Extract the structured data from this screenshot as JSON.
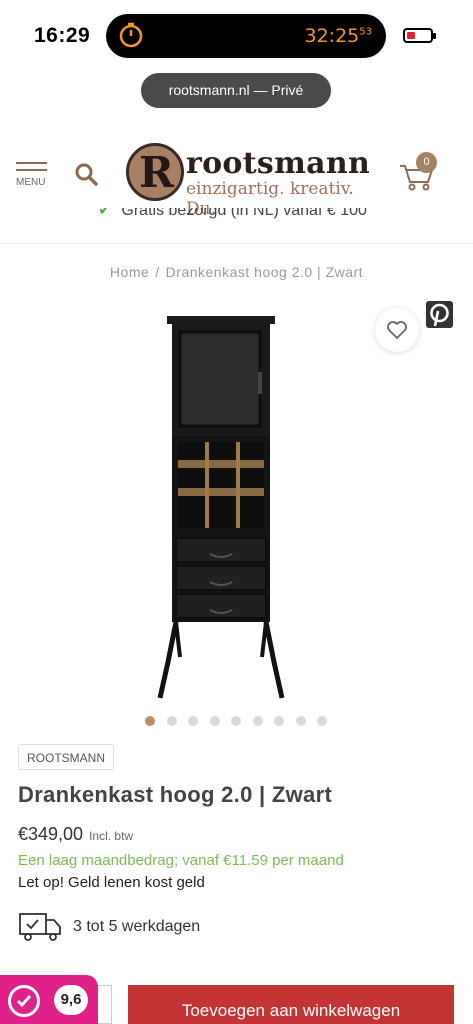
{
  "status_bar": {
    "time": "16:29",
    "timer": "32:25",
    "timer_sub": "53"
  },
  "browser": {
    "url": "rootsmann.nl — Privé"
  },
  "header": {
    "menu_label": "MENU",
    "logo_letter": "R",
    "logo_name": "rootsmann",
    "logo_tagline": "einzigartig. kreativ. Du.",
    "cart_count": "0"
  },
  "promo": {
    "text": "Gratis bezorgd (in NL) vanaf € 100"
  },
  "breadcrumb": {
    "home": "Home",
    "separator": "/",
    "current": "Drankenkast hoog 2.0 | Zwart"
  },
  "gallery": {
    "image_count": 9,
    "active_index": 0
  },
  "product": {
    "brand": "ROOTSMANN",
    "title": "Drankenkast hoog 2.0 | Zwart",
    "price": "€349,00",
    "price_note": "Incl. btw",
    "monthly": "Een laag maandbedrag; vanaf €11.59 per maand",
    "warning": "Let op! Geld lenen kost geld",
    "delivery": "3 tot 5 werkdagen"
  },
  "footer": {
    "rating_score": "9,6",
    "add_to_cart": "Toevoegen aan winkelwagen"
  },
  "colors": {
    "brand_brown": "#a3825f",
    "cta_red": "#c53434",
    "monthly_green": "#7cba5a",
    "kiyoh_pink": "#e0218a"
  }
}
